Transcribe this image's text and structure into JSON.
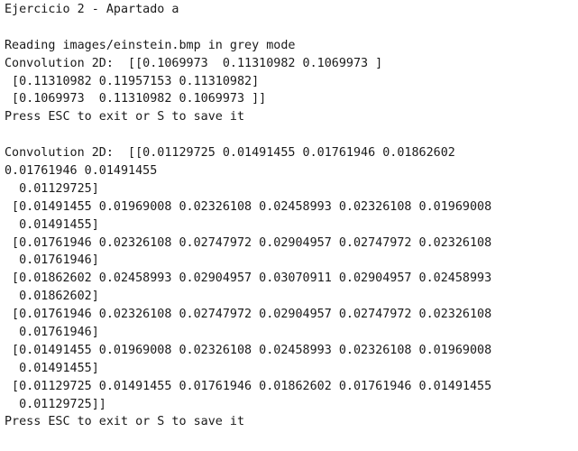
{
  "lines": [
    "Ejercicio 2 - Apartado a",
    "",
    "Reading images/einstein.bmp in grey mode",
    "Convolution 2D:  [[0.1069973  0.11310982 0.1069973 ]",
    " [0.11310982 0.11957153 0.11310982]",
    " [0.1069973  0.11310982 0.1069973 ]]",
    "Press ESC to exit or S to save it",
    "",
    "Convolution 2D:  [[0.01129725 0.01491455 0.01761946 0.01862602",
    "0.01761946 0.01491455",
    "  0.01129725]",
    " [0.01491455 0.01969008 0.02326108 0.02458993 0.02326108 0.01969008",
    "  0.01491455]",
    " [0.01761946 0.02326108 0.02747972 0.02904957 0.02747972 0.02326108",
    "  0.01761946]",
    " [0.01862602 0.02458993 0.02904957 0.03070911 0.02904957 0.02458993",
    "  0.01862602]",
    " [0.01761946 0.02326108 0.02747972 0.02904957 0.02747972 0.02326108",
    "  0.01761946]",
    " [0.01491455 0.01969008 0.02326108 0.02458993 0.02326108 0.01969008",
    "  0.01491455]",
    " [0.01129725 0.01491455 0.01761946 0.01862602 0.01761946 0.01491455",
    "  0.01129725]]",
    "Press ESC to exit or S to save it"
  ]
}
